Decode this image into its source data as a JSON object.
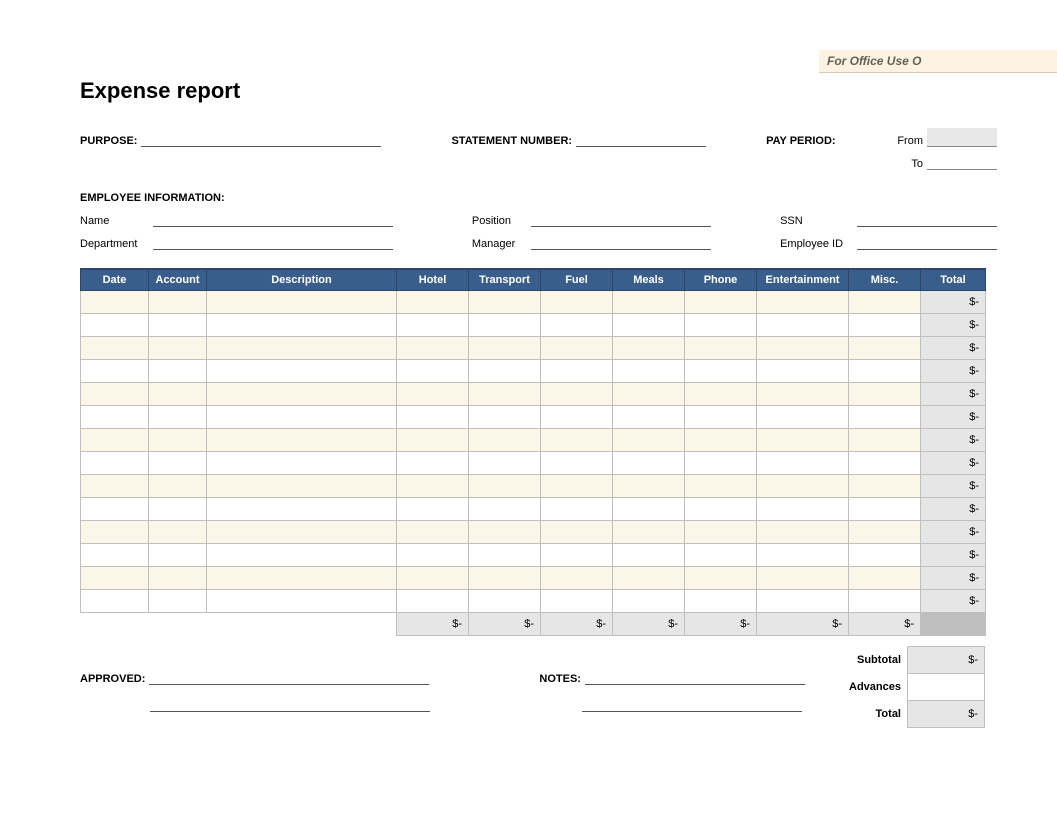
{
  "header": {
    "office_use": "For Office Use O",
    "title": "Expense report"
  },
  "fields": {
    "purpose_label": "PURPOSE:",
    "statement_label": "STATEMENT NUMBER:",
    "pay_period_label": "PAY PERIOD:",
    "pay_from": "From",
    "pay_to": "To",
    "emp_info_header": "EMPLOYEE INFORMATION:",
    "name_label": "Name",
    "position_label": "Position",
    "ssn_label": "SSN",
    "department_label": "Department",
    "manager_label": "Manager",
    "employee_id_label": "Employee ID",
    "approved_label": "APPROVED:",
    "notes_label": "NOTES:"
  },
  "table": {
    "columns": [
      "Date",
      "Account",
      "Description",
      "Hotel",
      "Transport",
      "Fuel",
      "Meals",
      "Phone",
      "Entertainment",
      "Misc.",
      "Total"
    ],
    "row_count": 14,
    "row_total_value": "$-",
    "col_total_value": "$-",
    "summary": {
      "subtotal_label": "Subtotal",
      "subtotal_value": "$-",
      "advances_label": "Advances",
      "advances_value": "",
      "total_label": "Total",
      "total_value": "$-"
    }
  }
}
